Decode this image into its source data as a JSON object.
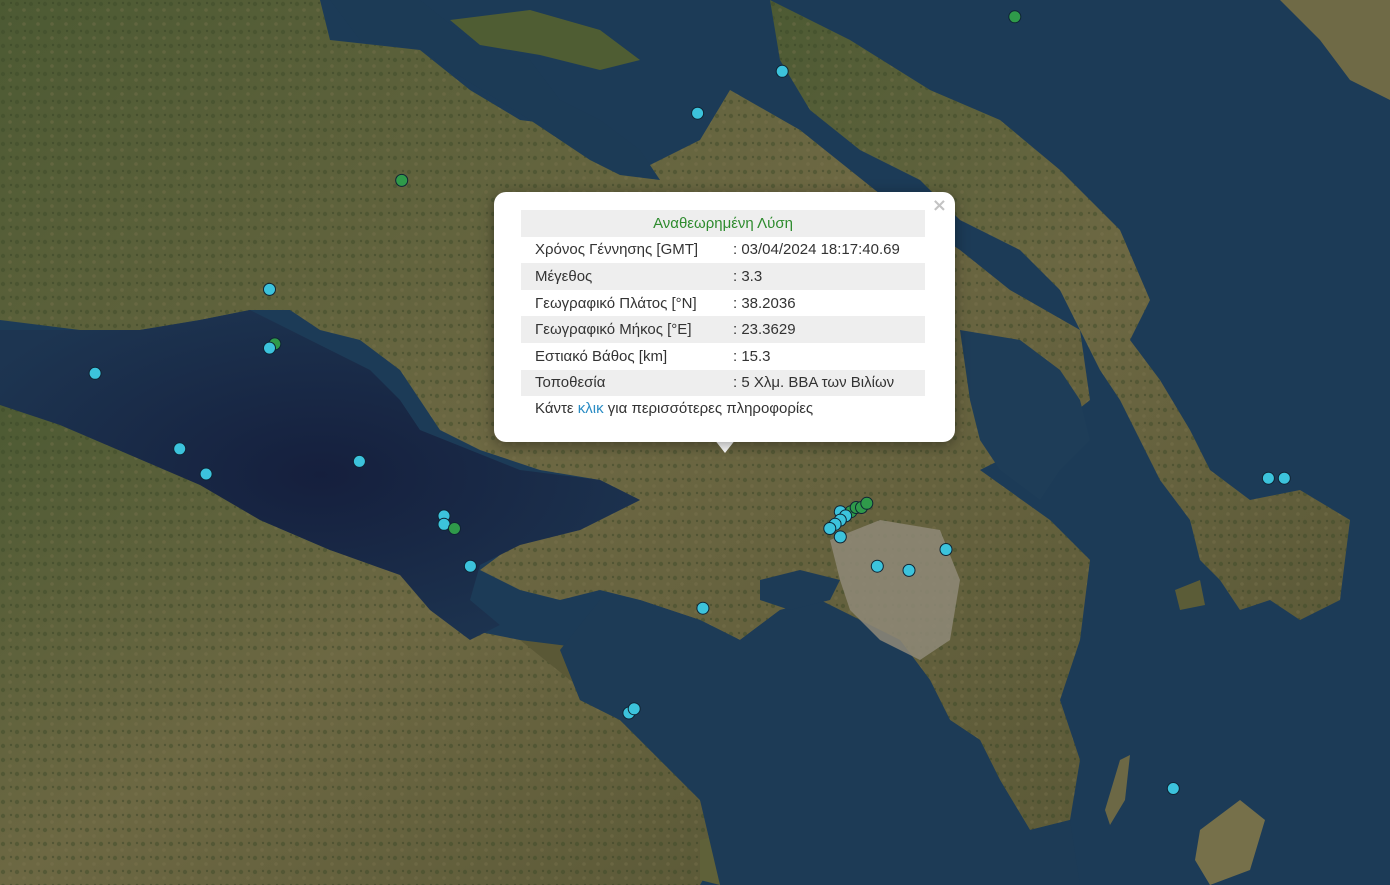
{
  "popup": {
    "title": "Αναθεωρημένη Λύση",
    "close_glyph": "×",
    "rows": [
      {
        "label": "Χρόνος Γέννησης [GMT]",
        "value": ": 03/04/2024 18:17:40.69"
      },
      {
        "label": "Μέγεθος",
        "value": ": 3.3"
      },
      {
        "label": "Γεωγραφικό Πλάτος [°N]",
        "value": ": 38.2036"
      },
      {
        "label": "Γεωγραφικό Μήκος [°E]",
        "value": ": 23.3629"
      },
      {
        "label": "Εστιακό Βάθος [km]",
        "value": ": 15.3"
      },
      {
        "label": "Τοποθεσία",
        "value": ": 5 Χλμ. ΒΒΑ των Βιλίων"
      }
    ],
    "more_prefix": "Κάντε",
    "more_link": "κλικ",
    "more_suffix": "για περισσότερες πληροφορίες"
  },
  "colors": {
    "sea": "#1b3a55",
    "sea_dark": "#14263f",
    "land": "#6b6a42",
    "land_green": "#46572e",
    "marker_cyan": "#3cc3dc",
    "marker_green": "#2f9a4a",
    "title_green": "#2e8b2e",
    "link_blue": "#2a8cc4"
  },
  "markers": [
    {
      "lon": 23.66,
      "lat": 39.05,
      "type": "green"
    },
    {
      "lon": 23.22,
      "lat": 38.92,
      "type": "cyan"
    },
    {
      "lon": 23.06,
      "lat": 38.82,
      "type": "cyan"
    },
    {
      "lon": 22.5,
      "lat": 38.66,
      "type": "green"
    },
    {
      "lon": 22.73,
      "lat": 38.55,
      "type": "cyan"
    },
    {
      "lon": 22.71,
      "lat": 38.54,
      "type": "cyan"
    },
    {
      "lon": 22.25,
      "lat": 38.4,
      "type": "cyan"
    },
    {
      "lon": 22.26,
      "lat": 38.27,
      "type": "green"
    },
    {
      "lon": 22.25,
      "lat": 38.26,
      "type": "cyan"
    },
    {
      "lon": 21.92,
      "lat": 38.2,
      "type": "cyan"
    },
    {
      "lon": 22.08,
      "lat": 38.02,
      "type": "cyan"
    },
    {
      "lon": 22.42,
      "lat": 37.99,
      "type": "cyan"
    },
    {
      "lon": 22.13,
      "lat": 37.96,
      "type": "cyan"
    },
    {
      "lon": 22.58,
      "lat": 37.86,
      "type": "cyan"
    },
    {
      "lon": 22.58,
      "lat": 37.84,
      "type": "cyan"
    },
    {
      "lon": 22.6,
      "lat": 37.83,
      "type": "green"
    },
    {
      "lon": 22.63,
      "lat": 37.74,
      "type": "cyan"
    },
    {
      "lon": 23.33,
      "lat": 37.87,
      "type": "cyan"
    },
    {
      "lon": 23.35,
      "lat": 37.87,
      "type": "green"
    },
    {
      "lon": 23.36,
      "lat": 37.88,
      "type": "green"
    },
    {
      "lon": 23.37,
      "lat": 37.88,
      "type": "green"
    },
    {
      "lon": 23.38,
      "lat": 37.89,
      "type": "green"
    },
    {
      "lon": 23.34,
      "lat": 37.86,
      "type": "cyan"
    },
    {
      "lon": 23.33,
      "lat": 37.85,
      "type": "cyan"
    },
    {
      "lon": 23.32,
      "lat": 37.84,
      "type": "cyan"
    },
    {
      "lon": 23.31,
      "lat": 37.83,
      "type": "cyan"
    },
    {
      "lon": 23.33,
      "lat": 37.81,
      "type": "cyan"
    },
    {
      "lon": 23.53,
      "lat": 37.78,
      "type": "cyan"
    },
    {
      "lon": 23.4,
      "lat": 37.74,
      "type": "cyan"
    },
    {
      "lon": 23.46,
      "lat": 37.73,
      "type": "cyan"
    },
    {
      "lon": 23.07,
      "lat": 37.64,
      "type": "cyan"
    },
    {
      "lon": 24.14,
      "lat": 37.95,
      "type": "cyan"
    },
    {
      "lon": 24.17,
      "lat": 37.95,
      "type": "cyan"
    },
    {
      "lon": 22.93,
      "lat": 37.39,
      "type": "cyan"
    },
    {
      "lon": 22.94,
      "lat": 37.4,
      "type": "cyan"
    },
    {
      "lon": 23.96,
      "lat": 37.21,
      "type": "cyan"
    }
  ]
}
